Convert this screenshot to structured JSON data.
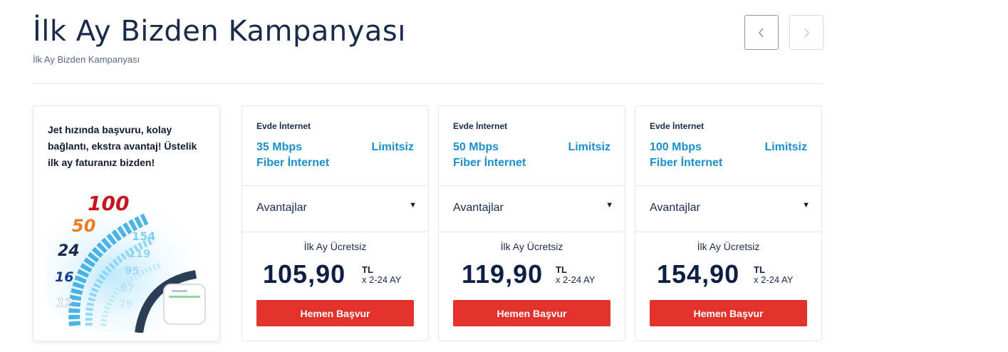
{
  "header": {
    "title": "İlk Ay Bizden Kampanyası",
    "subtitle": "İlk Ay Bizden Kampanyası"
  },
  "promo": {
    "text": "Jet hızında başvuru, kolay bağlantı, ekstra avantaj! Üstelik ilk ay faturanız bizden!"
  },
  "offers": [
    {
      "category": "Evde İnternet",
      "speed_line1": "35 Mbps",
      "speed_line2": "Fiber İnternet",
      "limit": "Limitsiz",
      "advantages_label": "Avantajlar",
      "promo_label": "İlk Ay Ücretsiz",
      "price": "105,90",
      "currency": "TL",
      "period": "x 2-24 AY",
      "cta": "Hemen Başvur"
    },
    {
      "category": "Evde İnternet",
      "speed_line1": "50 Mbps",
      "speed_line2": "Fiber İnternet",
      "limit": "Limitsiz",
      "advantages_label": "Avantajlar",
      "promo_label": "İlk Ay Ücretsiz",
      "price": "119,90",
      "currency": "TL",
      "period": "x 2-24 AY",
      "cta": "Hemen Başvur"
    },
    {
      "category": "Evde İnternet",
      "speed_line1": "100 Mbps",
      "speed_line2": "Fiber İnternet",
      "limit": "Limitsiz",
      "advantages_label": "Avantajlar",
      "promo_label": "İlk Ay Ücretsiz",
      "price": "154,90",
      "currency": "TL",
      "period": "x 2-24 AY",
      "cta": "Hemen Başvur"
    }
  ],
  "icons": {
    "prev": "chevron-left-icon",
    "next": "chevron-right-icon",
    "caret": "caret-down-icon"
  },
  "colors": {
    "accent_blue": "#1b8fc9",
    "cta_red": "#e2322b",
    "price_navy": "#0e1e44"
  }
}
